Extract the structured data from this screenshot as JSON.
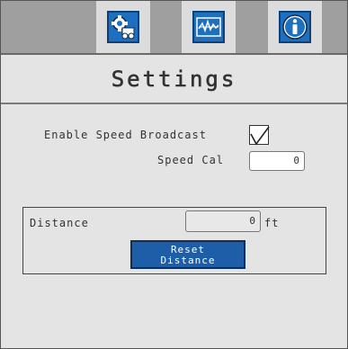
{
  "tabs": [
    {
      "name": "settings",
      "icon": "gear-tractor-icon"
    },
    {
      "name": "monitor",
      "icon": "waveform-icon"
    },
    {
      "name": "info",
      "icon": "info-icon"
    }
  ],
  "header": {
    "title": "Settings"
  },
  "speed_broadcast": {
    "label": "Enable Speed Broadcast",
    "checked": true
  },
  "speed_cal": {
    "label": "Speed Cal",
    "value": "0"
  },
  "distance": {
    "label": "Distance",
    "value": "0",
    "unit": "ft"
  },
  "reset_button": {
    "line1": "Reset",
    "line2": "Distance"
  },
  "colors": {
    "accent": "#1f6fbf",
    "button": "#1e5ea8",
    "background": "#e4e4e4"
  }
}
